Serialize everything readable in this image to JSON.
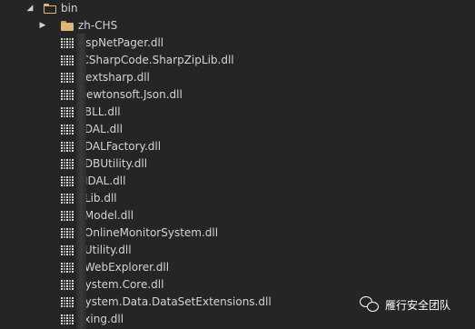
{
  "explorer": {
    "root_folder": {
      "name": "bin",
      "expanded": true
    },
    "sub_folder": {
      "name": "zh-CHS",
      "expanded": false
    },
    "files": [
      {
        "name": "AspNetPager.dll"
      },
      {
        "name": "ICSharpCode.SharpZipLib.dll"
      },
      {
        "name": "itextsharp.dll"
      },
      {
        "name": "Newtonsoft.Json.dll"
      },
      {
        "name": "FBLL.dll"
      },
      {
        "name": "FDAL.dll"
      },
      {
        "name": "FDALFactory.dll"
      },
      {
        "name": "FDBUtility.dll"
      },
      {
        "name": "FIDAL.dll"
      },
      {
        "name": "FLib.dll"
      },
      {
        "name": "FModel.dll"
      },
      {
        "name": "FOnlineMonitorSystem.dll"
      },
      {
        "name": "FUtility.dll"
      },
      {
        "name": "FWebExplorer.dll"
      },
      {
        "name": "System.Core.dll"
      },
      {
        "name": "System.Data.DataSetExtensions.dll"
      },
      {
        "name": "zxing.dll"
      }
    ]
  },
  "watermark": {
    "text": "雁行安全团队",
    "icon": "wechat-icon"
  },
  "colors": {
    "background": "#252526",
    "text": "#d4d4d4",
    "folder": "#dcb67a"
  }
}
